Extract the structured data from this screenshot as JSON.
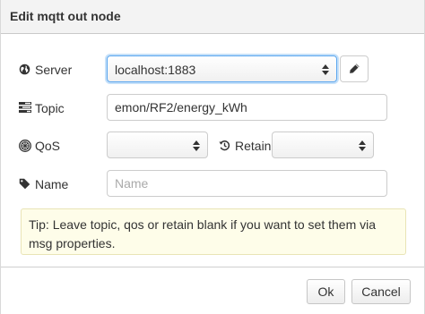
{
  "dialog": {
    "title": "Edit mqtt out node"
  },
  "form": {
    "server": {
      "label": "Server",
      "value": "localhost:1883",
      "icon": "globe-icon"
    },
    "topic": {
      "label": "Topic",
      "value": "emon/RF2/energy_kWh",
      "icon": "tasks-icon"
    },
    "qos": {
      "label": "QoS",
      "value": "",
      "icon": "empire-icon"
    },
    "retain": {
      "label": "Retain",
      "value": "",
      "icon": "history-icon"
    },
    "name": {
      "label": "Name",
      "value": "",
      "placeholder": "Name",
      "icon": "tag-icon"
    },
    "edit_server_button_icon": "pencil-icon"
  },
  "tip": {
    "text": "Tip: Leave topic, qos or retain blank if you want to set them via msg properties."
  },
  "footer": {
    "ok_label": "Ok",
    "cancel_label": "Cancel"
  },
  "colors": {
    "focus_border": "#5aa6ef",
    "tip_background": "#fefde9",
    "tip_border": "#e9e4b6"
  }
}
